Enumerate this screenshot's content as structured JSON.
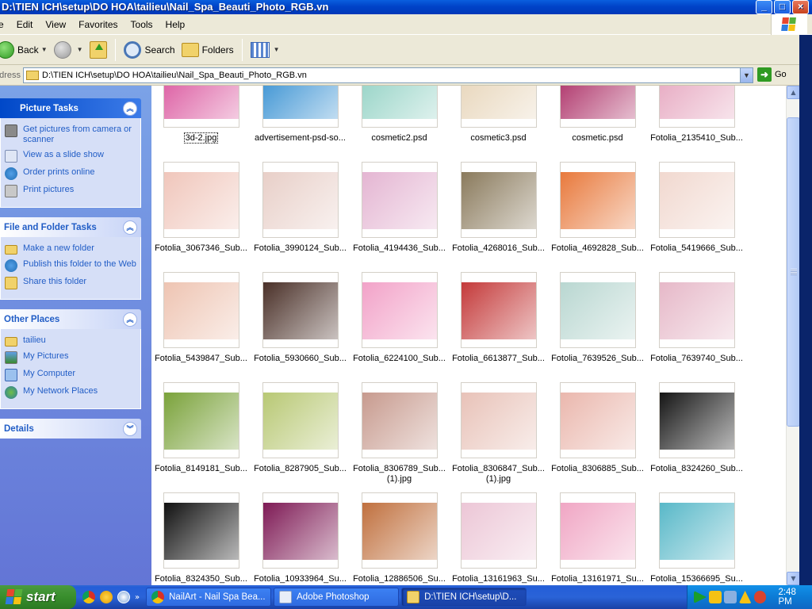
{
  "window": {
    "title": "D:\\TIEN ICH\\setup\\DO HOA\\tailieu\\Nail_Spa_Beauti_Photo_RGB.vn",
    "buttons": [
      "_",
      "□",
      "×"
    ]
  },
  "menu": [
    "e",
    "Edit",
    "View",
    "Favorites",
    "Tools",
    "Help"
  ],
  "toolbar": {
    "back": "Back",
    "search": "Search",
    "folders": "Folders"
  },
  "address": {
    "label": "Address",
    "value": "D:\\TIEN ICH\\setup\\DO HOA\\tailieu\\Nail_Spa_Beauti_Photo_RGB.vn",
    "go": "Go"
  },
  "taskpane": {
    "picture_tasks": {
      "title": "Picture Tasks",
      "items": [
        "Get pictures from camera or scanner",
        "View as a slide show",
        "Order prints online",
        "Print pictures"
      ]
    },
    "file_tasks": {
      "title": "File and Folder Tasks",
      "items": [
        "Make a new folder",
        "Publish this folder to the Web",
        "Share this folder"
      ]
    },
    "other_places": {
      "title": "Other Places",
      "items": [
        "tailieu",
        "My Pictures",
        "My Computer",
        "My Network Places"
      ]
    },
    "details": {
      "title": "Details"
    }
  },
  "files": [
    {
      "name": "3d-2.jpg",
      "selected": true,
      "color": "#d94f9a"
    },
    {
      "name": "advertisement-psd-so...",
      "color": "#2d8bd0"
    },
    {
      "name": "cosmetic2.psd",
      "color": "#8ed0c2"
    },
    {
      "name": "cosmetic3.psd",
      "color": "#e6d3b6"
    },
    {
      "name": "cosmetic.psd",
      "color": "#a8245e"
    },
    {
      "name": "Fotolia_2135410_Sub...",
      "color": "#e5a3bd"
    },
    {
      "name": "Fotolia_3067346_Sub...",
      "color": "#f0c6bb"
    },
    {
      "name": "Fotolia_3990124_Sub...",
      "color": "#e8cfc8"
    },
    {
      "name": "Fotolia_4194436_Sub...",
      "color": "#e4b5d2"
    },
    {
      "name": "Fotolia_4268016_Sub...",
      "color": "#8a7a5c"
    },
    {
      "name": "Fotolia_4692828_Sub...",
      "color": "#e8793c"
    },
    {
      "name": "Fotolia_5419666_Sub...",
      "color": "#f1d8cf"
    },
    {
      "name": "Fotolia_5439847_Sub...",
      "color": "#eec4b2"
    },
    {
      "name": "Fotolia_5930660_Sub...",
      "color": "#4a3028"
    },
    {
      "name": "Fotolia_6224100_Sub...",
      "color": "#f2a2c8"
    },
    {
      "name": "Fotolia_6613877_Sub...",
      "color": "#c43a3a"
    },
    {
      "name": "Fotolia_7639526_Sub...",
      "color": "#b9d7d1"
    },
    {
      "name": "Fotolia_7639740_Sub...",
      "color": "#e6b8c8"
    },
    {
      "name": "Fotolia_8149181_Sub...",
      "color": "#7aa23a"
    },
    {
      "name": "Fotolia_8287905_Sub...",
      "color": "#b8c874"
    },
    {
      "name": "Fotolia_8306789_Sub... (1).jpg",
      "color": "#c79a8e"
    },
    {
      "name": "Fotolia_8306847_Sub... (1).jpg",
      "color": "#e8c2b8"
    },
    {
      "name": "Fotolia_8306885_Sub...",
      "color": "#eab7ad"
    },
    {
      "name": "Fotolia_8324260_Sub...",
      "color": "#151515"
    },
    {
      "name": "Fotolia_8324350_Sub...",
      "color": "#111111"
    },
    {
      "name": "Fotolia_10933964_Su...",
      "color": "#7e1a55"
    },
    {
      "name": "Fotolia_12886506_Su...",
      "color": "#c0703e"
    },
    {
      "name": "Fotolia_13161963_Su...",
      "color": "#ecc6d6"
    },
    {
      "name": "Fotolia_13161971_Su...",
      "color": "#f0a6c4"
    },
    {
      "name": "Fotolia_15366695_Su...",
      "color": "#58b8c8"
    }
  ],
  "taskbar": {
    "start": "start",
    "buttons": [
      "NailArt - Nail Spa Bea...",
      "Adobe Photoshop",
      "D:\\TIEN ICH\\setup\\D..."
    ],
    "clock": "2:48 PM"
  },
  "colors": {
    "xp_blue": "#0A5FDE",
    "taskpane_link": "#215DC6",
    "start_green": "#388E2C"
  }
}
